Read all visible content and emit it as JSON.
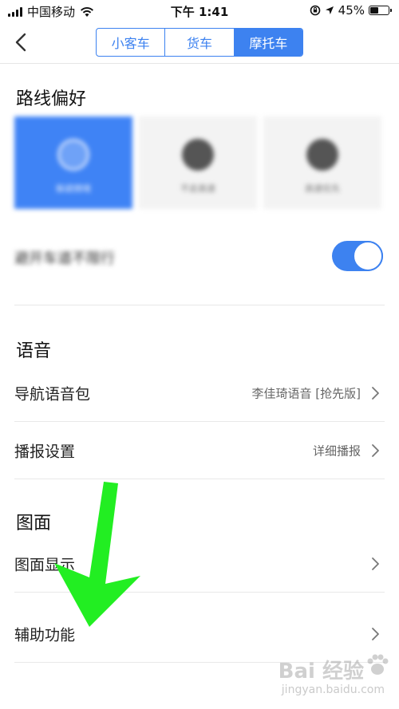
{
  "status_bar": {
    "carrier": "中国移动",
    "time": "下午 1:41",
    "battery": "45%",
    "battery_level": 0.45
  },
  "header": {
    "tabs": [
      {
        "label": "小客车",
        "active": false
      },
      {
        "label": "货车",
        "active": false
      },
      {
        "label": "摩托车",
        "active": true
      }
    ]
  },
  "route_pref": {
    "title": "路线偏好",
    "cards": [
      {
        "label": "躲避拥堵",
        "selected": true
      },
      {
        "label": "不走高速",
        "selected": false
      },
      {
        "label": "高速优先",
        "selected": false
      }
    ],
    "toggle_label": "避开车道不限行",
    "toggle_on": true
  },
  "voice": {
    "title": "语音",
    "rows": [
      {
        "label": "导航语音包",
        "value": "李佳琦语音 [抢先版]"
      },
      {
        "label": "播报设置",
        "value": "详细播报"
      }
    ]
  },
  "map": {
    "title": "图面",
    "rows": [
      {
        "label": "图面显示",
        "value": ""
      },
      {
        "label": "辅助功能",
        "value": ""
      }
    ]
  },
  "watermark": {
    "brand": "Bai 经验",
    "url": "jingyan.baidu.com"
  },
  "colors": {
    "accent": "#3d82f0",
    "arrow": "#22ee22"
  }
}
